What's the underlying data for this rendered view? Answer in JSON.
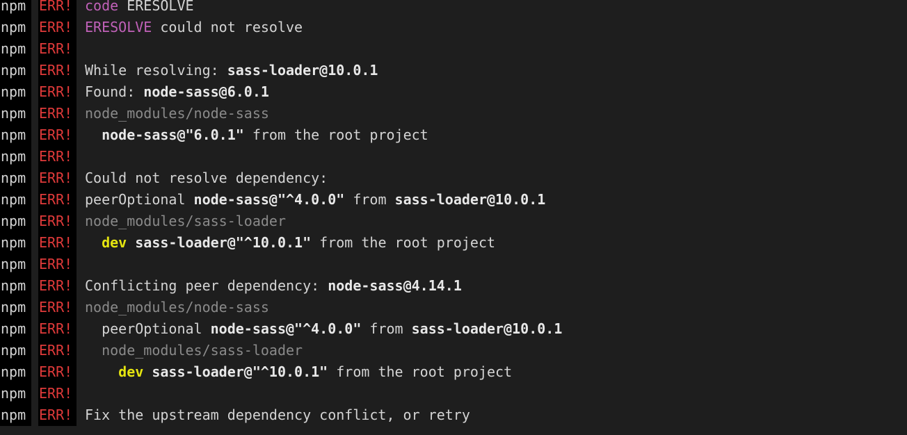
{
  "terminal": {
    "background_color": "#1e1e1e",
    "tag_background_color": "#000000",
    "colors": {
      "default_text": "#d4d4d4",
      "bold_text": "#e8e8e8",
      "dim_text": "#8a8a8a",
      "error_red": "#e03a3a",
      "magenta": "#c061b8",
      "yellow": "#e5e510"
    },
    "prefix": {
      "npm_label": "npm",
      "err_label": "ERR!"
    },
    "lines": [
      {
        "segments": [
          {
            "text": "code ",
            "style": "magenta"
          },
          {
            "text": "ERESOLVE",
            "style": "plain"
          }
        ]
      },
      {
        "segments": [
          {
            "text": "ERESOLVE",
            "style": "magenta"
          },
          {
            "text": " could not resolve",
            "style": "plain"
          }
        ]
      },
      {
        "segments": []
      },
      {
        "segments": [
          {
            "text": "While resolving: ",
            "style": "plain"
          },
          {
            "text": "sass-loader@10.0.1",
            "style": "bold"
          }
        ]
      },
      {
        "segments": [
          {
            "text": "Found: ",
            "style": "plain"
          },
          {
            "text": "node-sass@6.0.1",
            "style": "bold"
          }
        ]
      },
      {
        "segments": [
          {
            "text": "node_modules/node-sass",
            "style": "dim"
          }
        ]
      },
      {
        "segments": [
          {
            "text": "  ",
            "style": "plain"
          },
          {
            "text": "node-sass@\"6.0.1\"",
            "style": "bold"
          },
          {
            "text": " from the root project",
            "style": "plain"
          }
        ]
      },
      {
        "segments": []
      },
      {
        "segments": [
          {
            "text": "Could not resolve dependency:",
            "style": "plain"
          }
        ]
      },
      {
        "segments": [
          {
            "text": "peerOptional ",
            "style": "plain"
          },
          {
            "text": "node-sass@\"^4.0.0\"",
            "style": "bold"
          },
          {
            "text": " from ",
            "style": "plain"
          },
          {
            "text": "sass-loader@10.0.1",
            "style": "bold"
          }
        ]
      },
      {
        "segments": [
          {
            "text": "node_modules/sass-loader",
            "style": "dim"
          }
        ]
      },
      {
        "segments": [
          {
            "text": "  ",
            "style": "plain"
          },
          {
            "text": "dev",
            "style": "yellow"
          },
          {
            "text": " ",
            "style": "plain"
          },
          {
            "text": "sass-loader@\"^10.0.1\"",
            "style": "bold"
          },
          {
            "text": " from the root project",
            "style": "plain"
          }
        ]
      },
      {
        "segments": []
      },
      {
        "segments": [
          {
            "text": "Conflicting peer dependency: ",
            "style": "plain"
          },
          {
            "text": "node-sass@4.14.1",
            "style": "bold"
          }
        ]
      },
      {
        "segments": [
          {
            "text": "node_modules/node-sass",
            "style": "dim"
          }
        ]
      },
      {
        "segments": [
          {
            "text": "  peerOptional ",
            "style": "plain"
          },
          {
            "text": "node-sass@\"^4.0.0\"",
            "style": "bold"
          },
          {
            "text": " from ",
            "style": "plain"
          },
          {
            "text": "sass-loader@10.0.1",
            "style": "bold"
          }
        ]
      },
      {
        "segments": [
          {
            "text": "  node_modules/sass-loader",
            "style": "dim"
          }
        ]
      },
      {
        "segments": [
          {
            "text": "    ",
            "style": "plain"
          },
          {
            "text": "dev",
            "style": "yellow"
          },
          {
            "text": " ",
            "style": "plain"
          },
          {
            "text": "sass-loader@\"^10.0.1\"",
            "style": "bold"
          },
          {
            "text": " from the root project",
            "style": "plain"
          }
        ]
      },
      {
        "segments": []
      },
      {
        "segments": [
          {
            "text": "Fix the upstream dependency conflict, or retry",
            "style": "plain"
          }
        ]
      }
    ]
  }
}
